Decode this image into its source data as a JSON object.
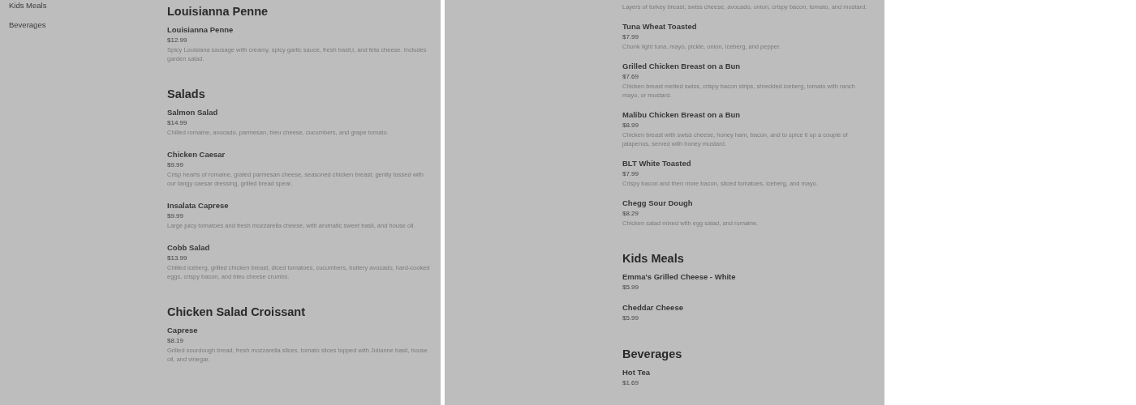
{
  "panels": [
    {
      "sidebar": [
        "Kids Meals",
        "Beverages"
      ],
      "sections": [
        {
          "heading": "Louisianna Penne",
          "items": [
            {
              "name": "Louisianna Penne",
              "price": "$12.99",
              "description": "Spicy Louisiana sausage with creamy, spicy garlic sauce, fresh basil,l, and feta cheese. Includes garden salad."
            }
          ]
        },
        {
          "heading": "Salads",
          "items": [
            {
              "name": "Salmon Salad",
              "price": "$14.99",
              "description": "Chilled romaine, avocado, parmesan, bleu cheese, cucumbers, and grape tomato."
            },
            {
              "name": "Chicken Caesar",
              "price": "$9.99",
              "description": "Crisp hearts of romaine, grated parmesan cheese, seasoned chicken breast, gently tossed with our tangy caesar dressing, grilled bread spear."
            },
            {
              "name": "Insalata Caprese",
              "price": "$9.99",
              "description": "Large juicy tomatoes and fresh mozzarella cheese, with aromatic sweet basil, and house oil."
            },
            {
              "name": "Cobb Salad",
              "price": "$13.99",
              "description": "Chilled iceberg, grilled chicken breast, diced tomatoes, cucumbers, buttery avocado, hard-cooked eggs, crispy bacon, and bleu cheese crumbs."
            }
          ]
        },
        {
          "heading": "Chicken Salad Croissant",
          "items": [
            {
              "name": "Caprese",
              "price": "$8.19",
              "description": "Grilled sourdough bread, fresh mozzarella slices, tomato slices topped with Julianne basil, house oil, and vinegar."
            }
          ]
        }
      ]
    },
    {
      "sections": [
        {
          "items": [
            {
              "description": "Layers of turkey breast, swiss cheese, avocado, onion, crispy bacon, tomato, and mustard."
            },
            {
              "name": "Tuna Wheat Toasted",
              "price": "$7.99",
              "description": "Chunk light tuna, mayo, pickle, onion, iceberg, and pepper."
            },
            {
              "name": "Grilled Chicken Breast on a Bun",
              "price": "$7.69",
              "description": "Chicken breast melted swiss, crispy bacon strips, shredded iceberg, tomato with ranch mayo, or mustard."
            },
            {
              "name": "Malibu Chicken Breast on a Bun",
              "price": "$8.99",
              "description": "Chicken breast with swiss cheese, honey ham, bacon, and to spice it up a couple of jalapenos, served with honey mustard."
            },
            {
              "name": "BLT White Toasted",
              "price": "$7.99",
              "description": "Crispy bacon and then more bacon, sliced tomatoes, iceberg, and mayo."
            },
            {
              "name": "Chegg Sour Dough",
              "price": "$8.29",
              "description": "Chicken salad mixed with egg salad, and romaine."
            }
          ]
        },
        {
          "heading": "Kids Meals",
          "items": [
            {
              "name": "Emma's Grilled Cheese - White",
              "price": "$5.99"
            },
            {
              "name": "Cheddar Cheese",
              "price": "$5.99"
            }
          ]
        },
        {
          "heading": "Beverages",
          "items": [
            {
              "name": "Hot Tea",
              "price": "$1.69"
            }
          ]
        }
      ]
    }
  ]
}
